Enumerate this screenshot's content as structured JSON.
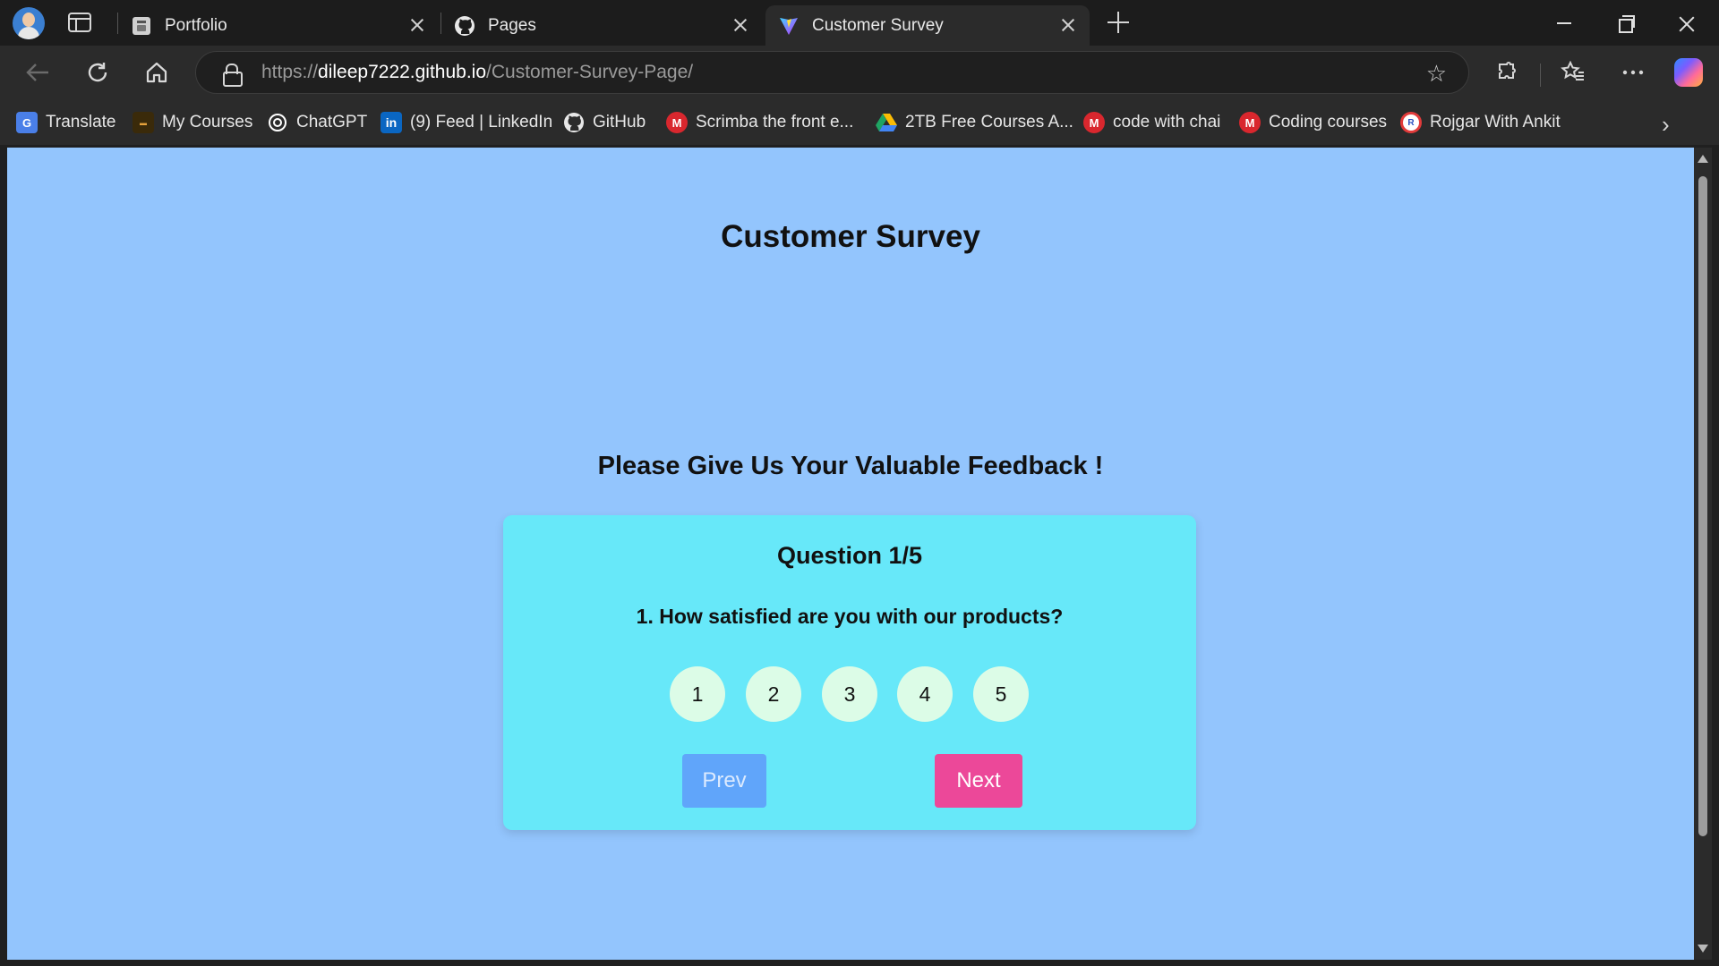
{
  "browser": {
    "tabs": [
      {
        "title": "Portfolio",
        "icon": "page-icon",
        "active": false
      },
      {
        "title": "Pages",
        "icon": "github-icon",
        "active": false
      },
      {
        "title": "Customer Survey",
        "icon": "vite-icon",
        "active": true
      }
    ],
    "url": {
      "scheme": "https://",
      "host": "dileep7222.github.io",
      "path": "/Customer-Survey-Page/"
    },
    "bookmarks": [
      {
        "label": "Translate",
        "icon": "google-translate-icon",
        "color": "#4a7fe8"
      },
      {
        "label": "My Courses",
        "icon": "college-logo-icon",
        "color": "#e6a23c"
      },
      {
        "label": "ChatGPT",
        "icon": "chatgpt-icon",
        "color": "#ffffff"
      },
      {
        "label": "(9) Feed | LinkedIn",
        "icon": "linkedin-icon",
        "color": "#0a66c2"
      },
      {
        "label": "GitHub",
        "icon": "github-icon",
        "color": "#ffffff"
      },
      {
        "label": "Scrimba the front e...",
        "icon": "mega-icon",
        "color": "#d9272e"
      },
      {
        "label": "2TB Free Courses A...",
        "icon": "google-drive-icon",
        "color": "#1fa463"
      },
      {
        "label": "code with chai",
        "icon": "mega-icon",
        "color": "#d9272e"
      },
      {
        "label": "Coding courses",
        "icon": "mega-icon",
        "color": "#d9272e"
      },
      {
        "label": "Rojgar With Ankit",
        "icon": "rojgar-icon",
        "color": "#e23b3b"
      }
    ]
  },
  "page": {
    "title": "Customer Survey",
    "feedback_heading": "Please Give Us Your Valuable Feedback !",
    "card": {
      "question_count": "Question 1/5",
      "question_text": "1. How satisfied are you with our products?",
      "ratings": [
        "1",
        "2",
        "3",
        "4",
        "5"
      ],
      "prev_label": "Prev",
      "next_label": "Next"
    }
  },
  "colors": {
    "page_background": "#93c5fd",
    "card_background": "#67e8f9",
    "rating_background": "#dcfce7",
    "prev_button": "#60a5fa",
    "next_button": "#ec4899"
  }
}
